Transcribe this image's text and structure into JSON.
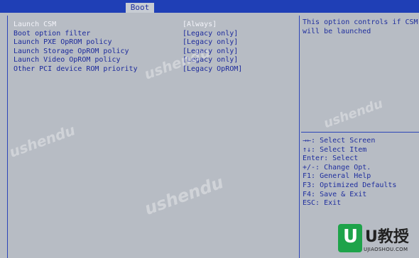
{
  "header": {
    "active_tab": "Boot"
  },
  "settings": [
    {
      "label": "Launch CSM",
      "value": "[Always]"
    },
    {
      "label": "Boot option filter",
      "value": "[Legacy only]"
    },
    {
      "label": "Launch PXE OpROM policy",
      "value": "[Legacy only]"
    },
    {
      "label": "Launch Storage OpROM policy",
      "value": "[Legacy only]"
    },
    {
      "label": "Launch Video OpROM policy",
      "value": "[Legacy only]"
    },
    {
      "label": "Other PCI device ROM priority",
      "value": "[Legacy OpROM]"
    }
  ],
  "help": {
    "text": "This option controls if CSM will be launched"
  },
  "keys": [
    "→←: Select Screen",
    "↑↓: Select Item",
    "Enter: Select",
    "+/-: Change Opt.",
    "F1: General Help",
    "F3: Optimized Defaults",
    "F4: Save & Exit",
    "ESC: Exit"
  ],
  "watermark": {
    "brand": "ushendu"
  },
  "logo": {
    "mark": "U",
    "name": "U教授",
    "url": "UJIAOSHOU.COM"
  },
  "colors": {
    "background": "#b7bcc4",
    "bar": "#1f3fb6",
    "text": "#1c2a9c",
    "highlight": "#f3f4fa",
    "logo_green": "#1ea34a"
  }
}
